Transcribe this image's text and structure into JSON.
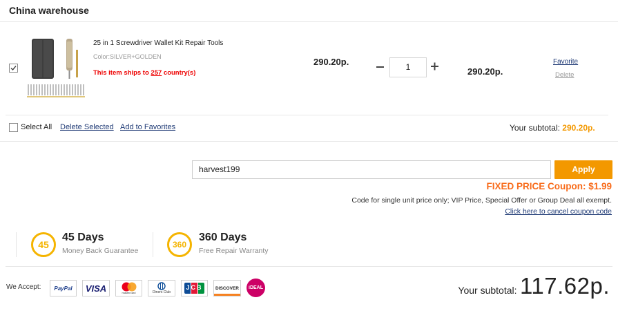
{
  "warehouse": {
    "title": "China warehouse"
  },
  "item": {
    "title": "25 in 1 Screwdriver Wallet Kit Repair Tools",
    "color": "Color:SILVER+GOLDEN",
    "ships_prefix": "This item ships to ",
    "ships_count": "257",
    "ships_suffix": " country(s)",
    "unit_price": "290.20p.",
    "quantity": "1",
    "total_price": "290.20p.",
    "favorite_label": "Favorite",
    "delete_label": "Delete",
    "checked": true
  },
  "cart_footer": {
    "select_all_label": "Select All",
    "delete_selected_label": "Delete Selected",
    "add_to_favorites_label": "Add to Favorites",
    "subtotal_label": "Your subtotal:",
    "subtotal_value": "290.20p."
  },
  "coupon": {
    "code": "harvest199",
    "apply_label": "Apply",
    "title": "FIXED PRICE Coupon: $1.99",
    "note": "Code for single unit price only; VIP Price, Special Offer or Group Deal all exempt.",
    "cancel_label": "Click here to cancel coupon code"
  },
  "guarantees": [
    {
      "badge": "45",
      "title": "45 Days",
      "subtitle": "Money Back Guarantee"
    },
    {
      "badge": "360",
      "title": "360 Days",
      "subtitle": "Free Repair Warranty"
    }
  ],
  "payment": {
    "we_accept_label": "We Accept:",
    "methods": [
      {
        "name": "paypal-icon",
        "text": "PayPal"
      },
      {
        "name": "visa-icon",
        "text": "VISA"
      },
      {
        "name": "mastercard-icon",
        "text": "mastercard"
      },
      {
        "name": "diners-club-icon",
        "text": "Diners Club"
      },
      {
        "name": "jcb-icon",
        "text": "JCB"
      },
      {
        "name": "discover-icon",
        "text": "DISCOVER"
      },
      {
        "name": "ideal-icon",
        "text": "iDEAL"
      }
    ]
  },
  "order_summary": {
    "subtotal_label": "Your subtotal:",
    "subtotal_value": "117.62p."
  },
  "colors": {
    "accent_orange": "#f39800",
    "coupon_orange": "#f86b1a",
    "link_blue": "#1f3a75",
    "warning_red": "#e00000",
    "badge_gold": "#f5b400"
  }
}
